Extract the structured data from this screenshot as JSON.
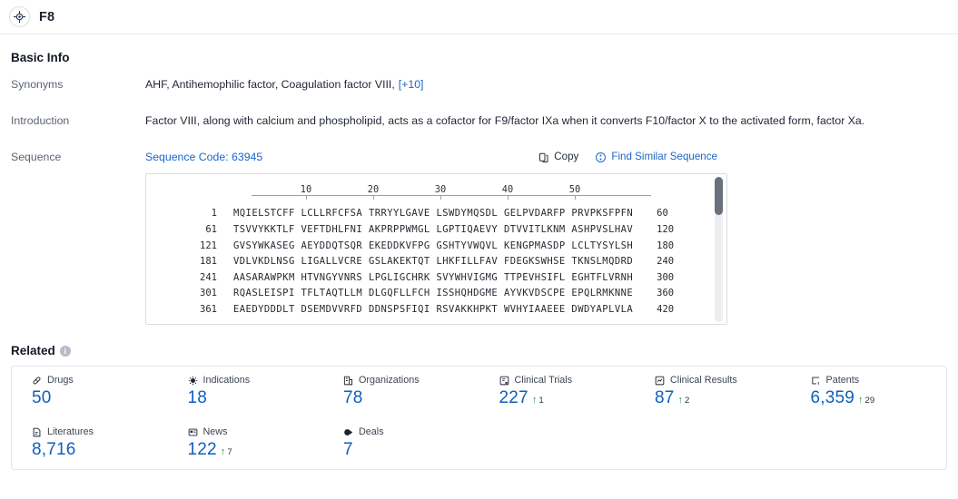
{
  "header": {
    "title": "F8",
    "avatar_icon": "target-crosshair-icon"
  },
  "basic_info": {
    "section_title": "Basic Info",
    "rows": [
      {
        "label": "Synonyms",
        "value": "AHF,  Antihemophilic factor,  Coagulation factor VIII,",
        "more": "[+10]"
      },
      {
        "label": "Introduction",
        "value": "Factor VIII, along with calcium and phospholipid, acts as a cofactor for F9/factor IXa when it converts F10/factor X to the activated form, factor Xa."
      },
      {
        "label": "Sequence"
      }
    ]
  },
  "sequence": {
    "code_label": "Sequence Code: 63945",
    "copy_label": "Copy",
    "copy_icon": "copy-icon",
    "find_similar_label": "Find Similar Sequence",
    "find_similar_icon": "find-similar-sequence-icon",
    "ruler_ticks": [
      "10",
      "20",
      "30",
      "40",
      "50"
    ],
    "rows": [
      {
        "start": "1",
        "chunks": "MQIELSTCFF LCLLRFCFSA TRRYYLGAVE LSWDYMQSDL GELPVDARFP PRVPKSFPFN",
        "end": "60"
      },
      {
        "start": "61",
        "chunks": "TSVVYKKTLF VEFTDHLFNI AKPRPPWMGL LGPTIQAEVY DTVVITLKNM ASHPVSLHAV",
        "end": "120"
      },
      {
        "start": "121",
        "chunks": "GVSYWKASEG AEYDDQTSQR EKEDDKVFPG GSHTYVWQVL KENGPMASDP LCLTYSYLSH",
        "end": "180"
      },
      {
        "start": "181",
        "chunks": "VDLVKDLNSG LIGALLVCRE GSLAKEKTQT LHKFILLFAV FDEGKSWHSE TKNSLMQDRD",
        "end": "240"
      },
      {
        "start": "241",
        "chunks": "AASARAWPKM HTVNGYVNRS LPGLIGCHRK SVYWHVIGMG TTPEVHSIFL EGHTFLVRNH",
        "end": "300"
      },
      {
        "start": "301",
        "chunks": "RQASLEISPI TFLTAQTLLM DLGQFLLFCH ISSHQHDGME AYVKVDSCPE EPQLRMKNNE",
        "end": "360"
      },
      {
        "start": "361",
        "chunks": "EAEDYDDDLT DSEMDVVRFD DDNSPSFIQI RSVAKKHPKT WVHYIAAEEE DWDYAPLVLA",
        "end": "420"
      }
    ]
  },
  "related": {
    "title": "Related",
    "info_icon": "info-icon",
    "stats": [
      {
        "label": "Drugs",
        "value": "50",
        "icon": "pill-icon"
      },
      {
        "label": "Indications",
        "value": "18",
        "icon": "virus-icon"
      },
      {
        "label": "Organizations",
        "value": "78",
        "icon": "building-icon"
      },
      {
        "label": "Clinical Trials",
        "value": "227",
        "icon": "clinical-trial-icon",
        "delta": "1",
        "delta_dir": "up"
      },
      {
        "label": "Clinical Results",
        "value": "87",
        "icon": "clinical-result-icon",
        "delta": "2",
        "delta_dir": "up"
      },
      {
        "label": "Patents",
        "value": "6,359",
        "icon": "patent-icon",
        "delta": "29",
        "delta_dir": "up"
      },
      {
        "label": "Literatures",
        "value": "8,716",
        "icon": "literature-icon"
      },
      {
        "label": "News",
        "value": "122",
        "icon": "news-icon",
        "delta": "7",
        "delta_dir": "up"
      },
      {
        "label": "Deals",
        "value": "7",
        "icon": "deal-icon"
      }
    ],
    "delta_arrow_glyph": "↑"
  },
  "colors": {
    "link_blue": "#1a66c9",
    "value_blue": "#0f5fbd",
    "delta_green": "#1f9d3f",
    "border": "#e3e6ea"
  }
}
